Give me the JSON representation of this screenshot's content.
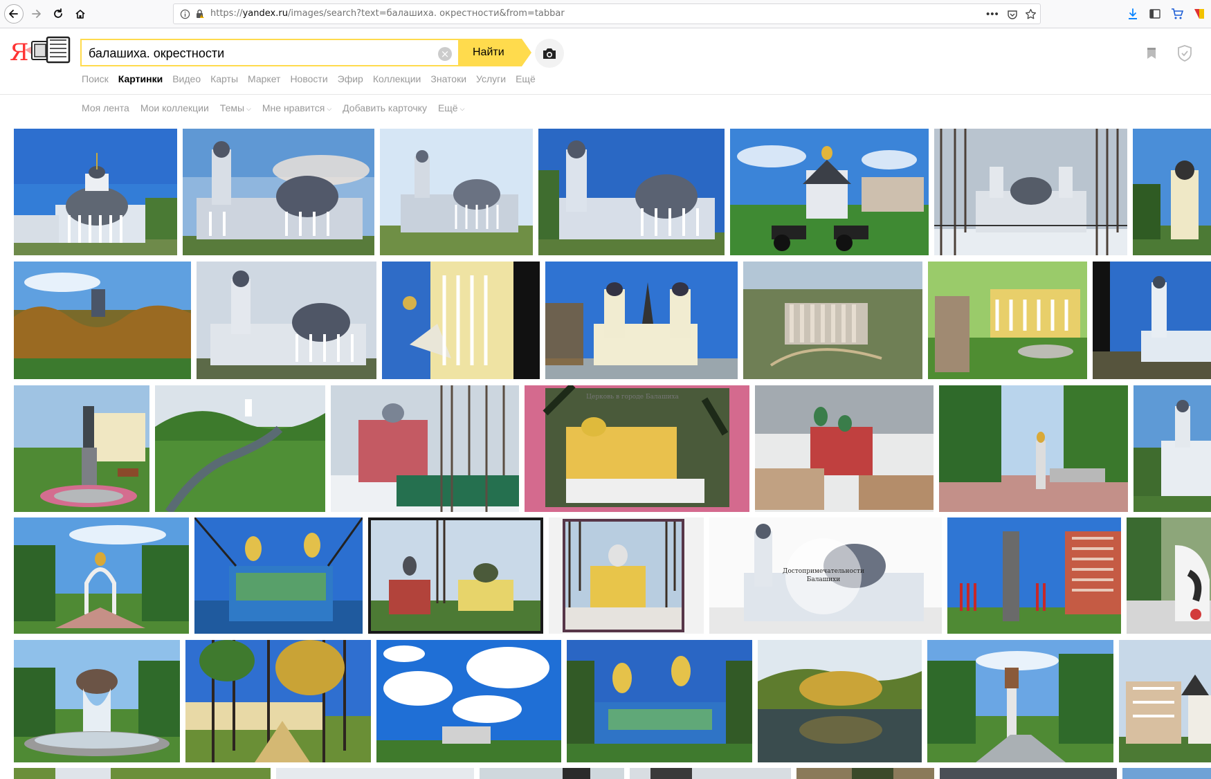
{
  "browser": {
    "url_prefix": "https://",
    "url_host": "yandex.ru",
    "url_path": "/images/search?text=балашиха. окрестности&from=tabbar",
    "more_label": "•••"
  },
  "header": {
    "logo_letter": "Я",
    "search_query": "балашиха. окрестности",
    "search_button": "Найти",
    "clear_symbol": "×"
  },
  "services": [
    {
      "label": "Поиск",
      "active": false
    },
    {
      "label": "Картинки",
      "active": true
    },
    {
      "label": "Видео",
      "active": false
    },
    {
      "label": "Карты",
      "active": false
    },
    {
      "label": "Маркет",
      "active": false
    },
    {
      "label": "Новости",
      "active": false
    },
    {
      "label": "Эфир",
      "active": false
    },
    {
      "label": "Коллекции",
      "active": false
    },
    {
      "label": "Знатоки",
      "active": false
    },
    {
      "label": "Услуги",
      "active": false
    },
    {
      "label": "Ещё",
      "active": false
    }
  ],
  "subnav": [
    {
      "label": "Моя лента",
      "caret": false
    },
    {
      "label": "Мои коллекции",
      "caret": false
    },
    {
      "label": "Темы",
      "caret": true
    },
    {
      "label": "Мне нравится",
      "caret": true
    },
    {
      "label": "Добавить карточку",
      "caret": false
    },
    {
      "label": "Ещё",
      "caret": true
    }
  ],
  "overlays": {
    "tile_3_3": "Церковь в городе Балашиха",
    "tile_4_6_line1": "Достопримечательности",
    "tile_4_6_line2": "Балашихи"
  },
  "colors": {
    "accent_yellow": "#ffdb4d",
    "logo_red": "#ff3333",
    "muted_text": "#999999"
  },
  "icons": [
    "back-arrow-icon",
    "forward-arrow-icon",
    "reload-icon",
    "home-icon",
    "info-icon",
    "lock-icon",
    "more-icon",
    "pocket-icon",
    "star-icon",
    "download-icon",
    "library-icon",
    "cart-icon",
    "extension-icon",
    "camera-icon",
    "bookmark-icon",
    "shield-icon"
  ]
}
